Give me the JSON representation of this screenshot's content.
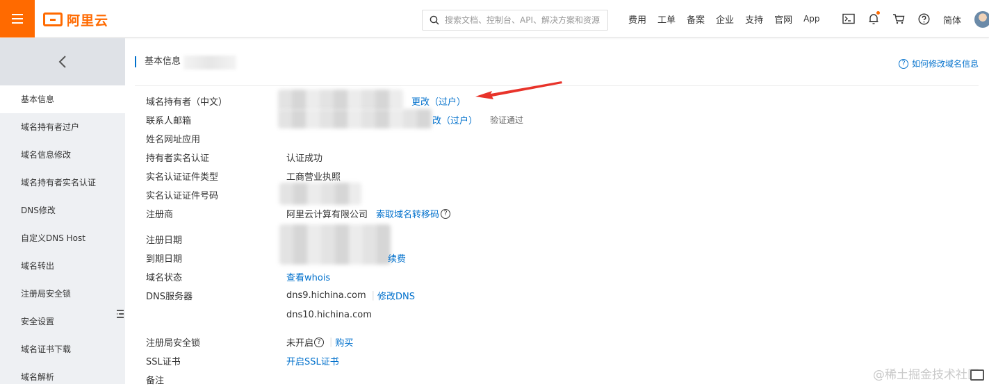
{
  "topbar": {
    "brand": "阿里云",
    "search_placeholder": "搜索文档、控制台、API、解决方案和资源",
    "nav": [
      "费用",
      "工单",
      "备案",
      "企业",
      "支持",
      "官网",
      "App"
    ],
    "lang": "简体",
    "accent": "#ff6a00"
  },
  "sidebar": {
    "items": [
      "基本信息",
      "域名持有者过户",
      "域名信息修改",
      "域名持有者实名认证",
      "DNS修改",
      "自定义DNS Host",
      "域名转出",
      "注册局安全锁",
      "安全设置",
      "域名证书下载",
      "域名解析"
    ],
    "active_index": 0
  },
  "main": {
    "section_title": "基本信息",
    "help_link": "如何修改域名信息",
    "rows": {
      "holder_cn": {
        "label": "域名持有者（中文）",
        "action": "更改（过户）"
      },
      "email": {
        "label": "联系人邮箱",
        "action": "更改（过户）",
        "action_visible": "改（过户）",
        "status": "验证通过"
      },
      "personal_site": {
        "label": "姓名网址应用"
      },
      "realname": {
        "label": "持有者实名认证",
        "value": "认证成功"
      },
      "doc_type": {
        "label": "实名认证证件类型",
        "value": "工商营业执照"
      },
      "doc_no": {
        "label": "实名认证证件号码"
      },
      "registrar": {
        "label": "注册商",
        "value": "阿里云计算有限公司",
        "action": "索取域名转移码"
      },
      "reg_date": {
        "label": "注册日期"
      },
      "exp_date": {
        "label": "到期日期",
        "action": "续费"
      },
      "status": {
        "label": "域名状态",
        "action": "查看whois"
      },
      "dns": {
        "label": "DNS服务器",
        "value1": "dns9.hichina.com",
        "action": "修改DNS",
        "value2": "dns10.hichina.com"
      },
      "lock": {
        "label": "注册局安全锁",
        "value": "未开启",
        "action": "购买"
      },
      "ssl": {
        "label": "SSL证书",
        "action": "开启SSL证书"
      },
      "remark": {
        "label": "备注"
      }
    }
  },
  "watermark": "@稀土掘金技术社区",
  "colors": {
    "link": "#0070cc",
    "sidebar_bg": "#eef0f3",
    "arrow": "#e8332a"
  }
}
